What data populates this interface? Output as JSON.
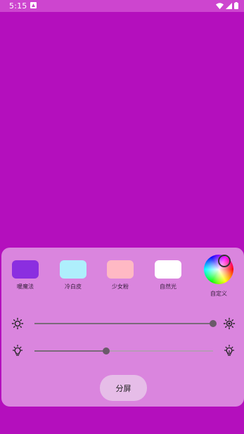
{
  "status_bar": {
    "time": "5:15"
  },
  "colors": {
    "background": "#b40fbd",
    "panel": "#da85de",
    "status_bar": "#cd45cf"
  },
  "presets": [
    {
      "label": "暖魔法",
      "color": "#8b2ee0"
    },
    {
      "label": "冷白皮",
      "color": "#aeeffc"
    },
    {
      "label": "少女粉",
      "color": "#ffb9c4"
    },
    {
      "label": "自然光",
      "color": "#ffffff"
    }
  ],
  "custom": {
    "label": "自定义",
    "icon": "color-wheel-icon"
  },
  "sliders": {
    "brightness": {
      "icon_left": "brightness-low-icon",
      "icon_right": "brightness-high-icon",
      "value": 1.0
    },
    "color_temperature": {
      "icon_left": "bulb-dim-icon",
      "icon_right": "bulb-bright-icon",
      "value": 0.4
    }
  },
  "split_button_label": "分屏"
}
